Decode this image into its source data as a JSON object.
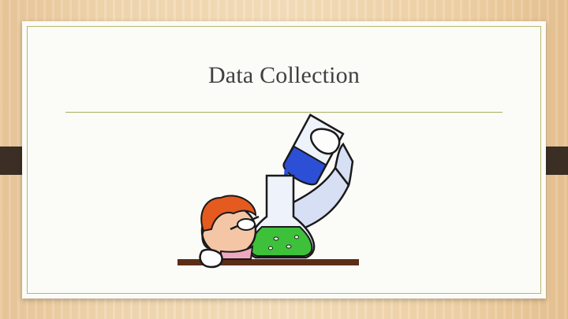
{
  "slide": {
    "title": "Data Collection",
    "illustration": "scientist-pouring-beaker-into-flask",
    "colors": {
      "frame_tab": "#3b2e25",
      "rule": "#a8ae5f",
      "title": "#404040",
      "liquid_blue": "#2d4fd6",
      "liquid_green": "#3ec13a",
      "hair": "#e55a1f"
    }
  }
}
